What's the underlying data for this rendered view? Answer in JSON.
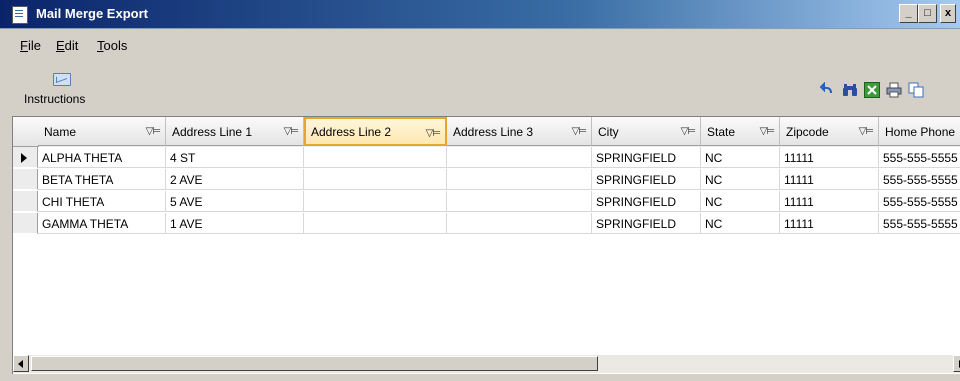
{
  "window": {
    "title": "Mail Merge Export",
    "controls": {
      "minimize": "_",
      "maximize": "□",
      "close": "x"
    }
  },
  "menu": [
    {
      "mnemonic": "F",
      "rest": "ile"
    },
    {
      "mnemonic": "E",
      "rest": "dit"
    },
    {
      "mnemonic": "T",
      "rest": "ools"
    }
  ],
  "toolbar": {
    "instructions_label": "Instructions",
    "icons": [
      "undo-icon",
      "find-icon",
      "excel-export-icon",
      "print-icon",
      "copy-icon"
    ]
  },
  "grid": {
    "columns": [
      "Name",
      "Address Line 1",
      "Address Line 2",
      "Address Line 3",
      "City",
      "State",
      "Zipcode",
      "Home Phone"
    ],
    "active_column": "Address Line 2",
    "filter_glyph": "▽⊨",
    "rows": [
      [
        "ALPHA THETA",
        "4 ST",
        "",
        "",
        "SPRINGFIELD",
        "NC",
        "11111",
        "555-555-5555"
      ],
      [
        "BETA THETA",
        "2 AVE",
        "",
        "",
        "SPRINGFIELD",
        "NC",
        "11111",
        "555-555-5555"
      ],
      [
        "CHI THETA",
        "5 AVE",
        "",
        "",
        "SPRINGFIELD",
        "NC",
        "11111",
        "555-555-5555"
      ],
      [
        "GAMMA THETA",
        "1 AVE",
        "",
        "",
        "SPRINGFIELD",
        "NC",
        "11111",
        "555-555-5555"
      ]
    ],
    "current_row": 0
  }
}
